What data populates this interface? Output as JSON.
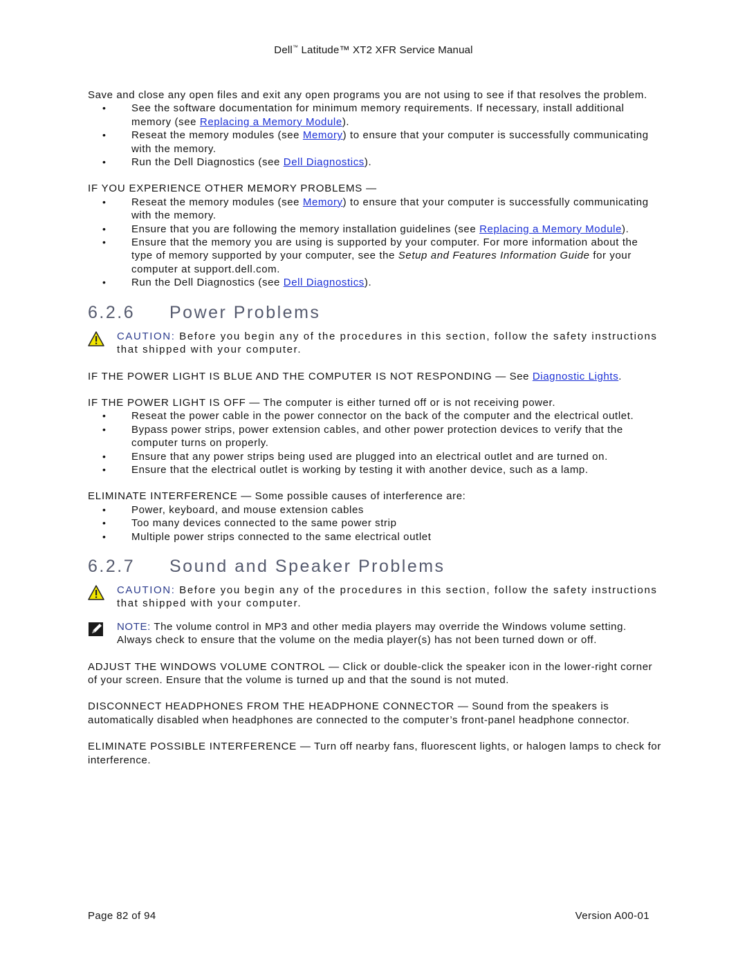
{
  "header": {
    "brand": "Dell",
    "tm": "™",
    "title_rest": " Latitude™ XT2 XFR Service Manual"
  },
  "intro": {
    "text": "Save and close any open files and exit any open programs you are not using to see if that resolves the problem.",
    "bullets": [
      {
        "pre": "See the software documentation for minimum memory requirements. If necessary, install additional memory (see ",
        "link": "Replacing a Memory Module",
        "post": ")."
      },
      {
        "pre": "Reseat the memory modules (see ",
        "link": "Memory",
        "post": ") to ensure that your computer is successfully communicating with the memory."
      },
      {
        "pre": "Run the Dell Diagnostics (see ",
        "link": "Dell Diagnostics",
        "post": ")."
      }
    ]
  },
  "other_memory": {
    "heading": "IF YOU EXPERIENCE OTHER MEMORY PROBLEMS —",
    "bullets": [
      {
        "pre": "Reseat the memory modules (see ",
        "link": "Memory",
        "post": ") to ensure that your computer is successfully communicating with the memory."
      },
      {
        "pre": "Ensure that you are following the memory installation guidelines (see ",
        "link": "Replacing a Memory Module",
        "post": ")."
      },
      {
        "pre": "Ensure that the memory you are using is supported by your computer. For more information about the type of memory supported by your computer, see the ",
        "italic": "Setup and Features Information Guide",
        "post": " for your computer at support.dell.com."
      },
      {
        "pre": "Run the Dell Diagnostics (see ",
        "link": "Dell Diagnostics",
        "post": ")."
      }
    ]
  },
  "power": {
    "number": "6.2.6",
    "title": "Power Problems",
    "caution_label": "CAUTION:",
    "caution_text": " Before you begin any of the procedures in this section, follow the safety instructions that shipped with your computer.",
    "blue_light": {
      "lead": "IF THE POWER LIGHT IS BLUE AND THE COMPUTER IS NOT RESPONDING",
      "dash": " — See ",
      "link": "Diagnostic Lights",
      "post": "."
    },
    "light_off": {
      "lead": "IF THE POWER LIGHT IS OFF",
      "text": " — The computer is either turned off or is not receiving power.",
      "bullets": [
        "Reseat the power cable in the power connector on the back of the computer and the electrical outlet.",
        "Bypass power strips, power extension cables, and other power protection devices to verify that the computer turns on properly.",
        "Ensure that any power strips being used are plugged into an electrical outlet and are turned on.",
        "Ensure that the electrical outlet is working by testing it with another device, such as a lamp."
      ]
    },
    "interference": {
      "lead": "ELIMINATE INTERFERENCE",
      "text": " — Some possible causes of interference are:",
      "bullets": [
        "Power, keyboard, and mouse extension cables",
        "Too many devices connected to the same power strip",
        "Multiple power strips connected to the same electrical outlet"
      ]
    }
  },
  "sound": {
    "number": "6.2.7",
    "title": "Sound and Speaker Problems",
    "caution_label": "CAUTION:",
    "caution_text": " Before you begin any of the procedures in this section, follow the safety instructions that shipped with your computer.",
    "note_label": "NOTE:",
    "note_text": " The volume control in MP3 and other media players may override the Windows volume setting. Always check to ensure that the volume on the media player(s) has not been turned down or off.",
    "volume": {
      "lead": "ADJUST THE WINDOWS VOLUME CONTROL",
      "text": " — Click or double-click the speaker icon in the lower-right corner of your screen. Ensure that the volume is turned up and that the sound is not muted."
    },
    "headphones": {
      "lead": "DISCONNECT HEADPHONES FROM THE HEADPHONE CONNECTOR",
      "text": " — Sound from the speakers is automatically disabled when headphones are connected to the computer’s front-panel headphone connector."
    },
    "interference": {
      "lead": "ELIMINATE POSSIBLE INTERFERENCE",
      "text": " — Turn off nearby fans, fluorescent lights, or halogen lamps to check for interference."
    }
  },
  "footer": {
    "page": "Page 82 of 94",
    "version": "Version A00-01"
  },
  "colors": {
    "link": "#1a2fd6",
    "heading": "#555a6e",
    "notice_label": "#2a3a8c",
    "caution_icon": "#f2e600"
  }
}
